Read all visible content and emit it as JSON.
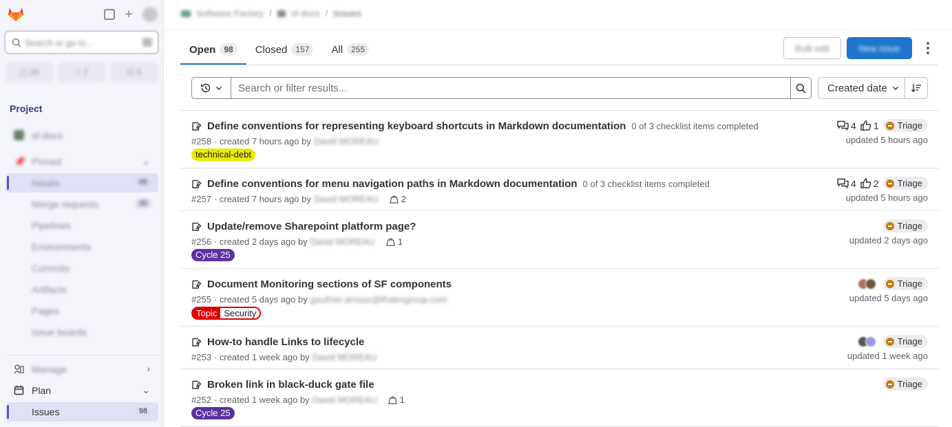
{
  "sidebar": {
    "search_placeholder": "Search or go to...",
    "counts": [
      {
        "icon": "issues-icon",
        "value": "20"
      },
      {
        "icon": "merge-request-icon",
        "value": "7"
      },
      {
        "icon": "todo-icon",
        "value": "5"
      }
    ],
    "heading": "Project",
    "project_name": "sf-docs",
    "pinned_label": "Pinned",
    "pinned_items": [
      {
        "label": "Issues",
        "badge": "98"
      },
      {
        "label": "Merge requests",
        "badge": "30"
      },
      {
        "label": "Pipelines"
      },
      {
        "label": "Environments"
      },
      {
        "label": "Commits"
      },
      {
        "label": "Artifacts"
      },
      {
        "label": "Pages"
      },
      {
        "label": "Issue boards"
      }
    ],
    "manage_label": "Manage",
    "plan_label": "Plan",
    "plan_issues_label": "Issues",
    "plan_issues_badge": "98"
  },
  "breadcrumb": [
    "Software Factory",
    "sf-docs",
    "Issues"
  ],
  "tabs": [
    {
      "label": "Open",
      "count": "98"
    },
    {
      "label": "Closed",
      "count": "157"
    },
    {
      "label": "All",
      "count": "255"
    }
  ],
  "actions": {
    "bulk_edit": "Bulk edit",
    "new_issue": "New issue"
  },
  "filter": {
    "placeholder": "Search or filter results...",
    "sort_label": "Created date"
  },
  "issues": [
    {
      "title": "Define conventions for representing keyboard shortcuts in Markdown documentation",
      "checklist": "0 of 3 checklist items completed",
      "ref": "#258",
      "created": "· created 7 hours ago by",
      "author": "David MOREAU",
      "comments": "4",
      "upvotes": "1",
      "status": "Triage",
      "updated": "updated 5 hours ago",
      "label": "technical-debt"
    },
    {
      "title": "Define conventions for menu navigation paths in Markdown documentation",
      "checklist": "0 of 3 checklist items completed",
      "ref": "#257",
      "created": "· created 7 hours ago by",
      "author": "David MOREAU",
      "weight": "2",
      "comments": "4",
      "upvotes": "2",
      "status": "Triage",
      "updated": "updated 5 hours ago"
    },
    {
      "title": "Update/remove Sharepoint platform page?",
      "ref": "#256",
      "created": "· created 2 days ago by",
      "author": "David MOREAU",
      "weight": "1",
      "status": "Triage",
      "updated": "updated 2 days ago",
      "label": "Cycle 25"
    },
    {
      "title": "Document Monitoring sections of SF components",
      "ref": "#255",
      "created": "· created 5 days ago by",
      "author": "gauthier.arnoux@thalesgroup.com",
      "status": "Triage",
      "updated": "updated 5 days ago",
      "scoped_key": "Topic",
      "scoped_value": "Security"
    },
    {
      "title": "How-to handle Links to lifecycle",
      "ref": "#253",
      "created": "· created 1 week ago by",
      "author": "David MOREAU",
      "status": "Triage",
      "updated": "updated 1 week ago"
    },
    {
      "title": "Broken link in black-duck gate file",
      "ref": "#252",
      "created": "· created 1 week ago by",
      "author": "David MOREAU",
      "weight": "1",
      "status": "Triage",
      "label": "Cycle 25"
    }
  ],
  "colors": {
    "accent": "#1f75cb",
    "sidebar_active": "#5a4fcf",
    "label_yellow": "#eaea00",
    "label_purple": "#5a32a3",
    "label_red": "#e00000",
    "triage": "#c17d10"
  }
}
